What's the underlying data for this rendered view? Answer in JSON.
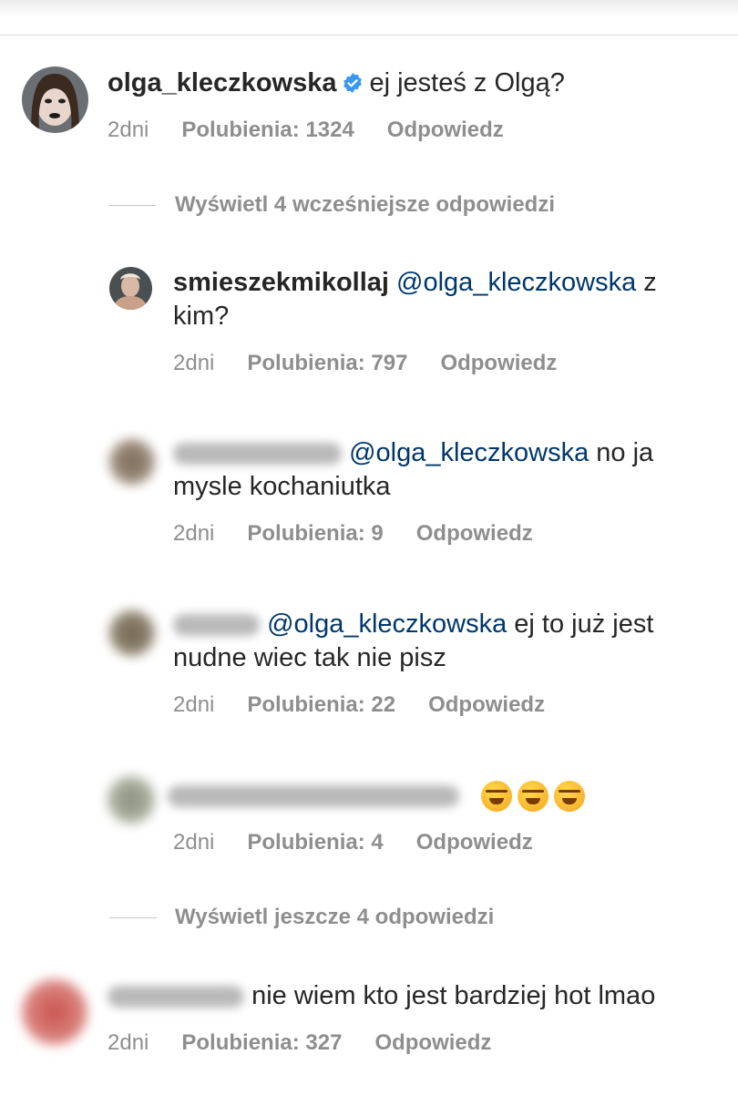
{
  "comments": [
    {
      "username": "olga_kleczkowska",
      "verified": true,
      "text": "ej jesteś z Olgą?",
      "time": "2dni",
      "likes": "Polubienia: 1324",
      "reply": "Odpowiedz"
    }
  ],
  "view_previous": "Wyświetl 4 wcześniejsze odpowiedzi",
  "replies": [
    {
      "username": "smieszekmikollaj",
      "mention": "@olga_kleczkowska",
      "text_tail": "z",
      "text_line2": "kim?",
      "time": "2dni",
      "likes": "Polubienia: 797",
      "reply": "Odpowiedz"
    },
    {
      "mention": "@olga_kleczkowska",
      "text_tail": "no ja",
      "text_line2": "mysle kochaniutka",
      "time": "2dni",
      "likes": "Polubienia: 9",
      "reply": "Odpowiedz"
    },
    {
      "mention": "@olga_kleczkowska",
      "text_tail": "ej to już jest",
      "text_line2": "nudne wiec tak nie pisz",
      "time": "2dni",
      "likes": "Polubienia: 22",
      "reply": "Odpowiedz"
    },
    {
      "time": "2dni",
      "likes": "Polubienia: 4",
      "reply": "Odpowiedz",
      "emoji": "rolling-on-floor-laughing"
    }
  ],
  "view_more": "Wyświetl jeszcze 4 odpowiedzi",
  "last_comment": {
    "text": "nie wiem kto jest bardziej hot lmao",
    "time": "2dni",
    "likes": "Polubienia: 327",
    "reply": "Odpowiedz"
  },
  "colors": {
    "mention": "#00376b",
    "meta": "#8e8e8e",
    "verified": "#3897f0"
  }
}
